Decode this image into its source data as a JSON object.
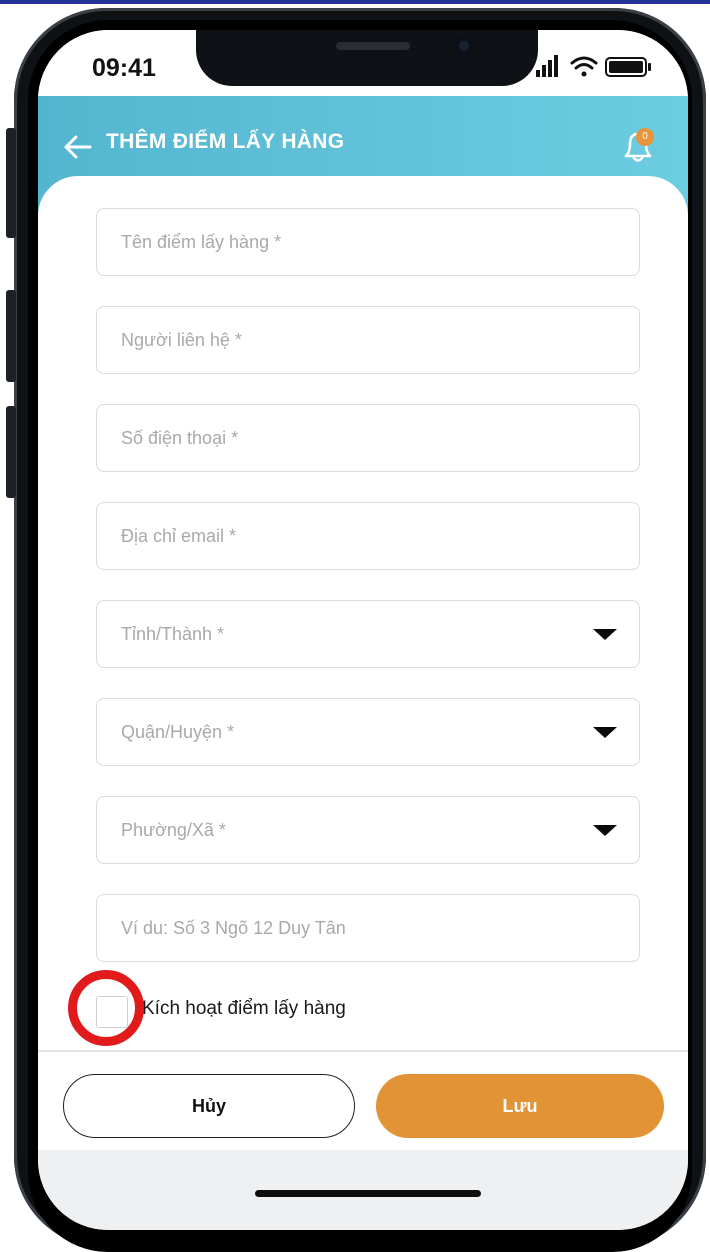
{
  "status_bar": {
    "time": "09:41"
  },
  "header": {
    "title": "THÊM ĐIỂM LẤY HÀNG",
    "back_icon": "arrow-left-icon",
    "bell_icon": "bell-icon",
    "notification_count": "0"
  },
  "form": {
    "fields": [
      {
        "placeholder": "Tên điểm lấy hàng *",
        "value": "",
        "type": "text"
      },
      {
        "placeholder": "Người liên hệ *",
        "value": "",
        "type": "text"
      },
      {
        "placeholder": "Số điện thoại *",
        "value": "",
        "type": "text"
      },
      {
        "placeholder": "Địa chỉ email *",
        "value": "",
        "type": "text"
      },
      {
        "placeholder": "Tỉnh/Thành *",
        "value": "",
        "type": "select"
      },
      {
        "placeholder": "Quận/Huyện *",
        "value": "",
        "type": "select"
      },
      {
        "placeholder": "Phường/Xã *",
        "value": "",
        "type": "select"
      },
      {
        "placeholder": "Ví du: Số 3 Ngõ 12 Duy Tân",
        "value": "",
        "type": "text"
      }
    ],
    "activate_checkbox": {
      "label": "Kích hoạt điểm lấy hàng",
      "checked": false
    }
  },
  "actions": {
    "cancel_label": "Hủy",
    "save_label": "Lưu"
  },
  "colors": {
    "header_gradient_start": "#54b5cf",
    "header_gradient_end": "#6ccde2",
    "save_button": "#e29336",
    "badge": "#e8943a",
    "highlight_ring": "#e11b1b"
  }
}
